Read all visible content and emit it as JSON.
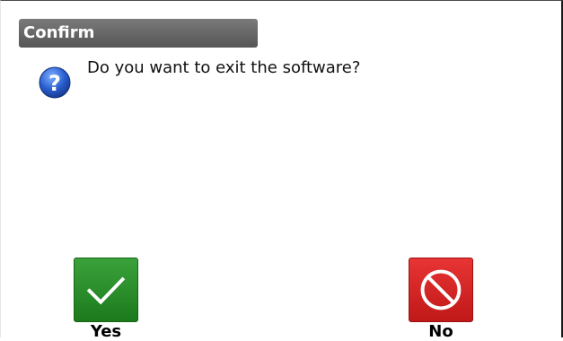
{
  "dialog": {
    "title": "Confirm",
    "message": "Do you want to exit the software?",
    "icon": "question-icon"
  },
  "buttons": {
    "yes": {
      "label": "Yes",
      "icon": "checkmark-icon",
      "color": "#2a8f2a"
    },
    "no": {
      "label": "No",
      "icon": "prohibited-icon",
      "color": "#d62424"
    }
  }
}
